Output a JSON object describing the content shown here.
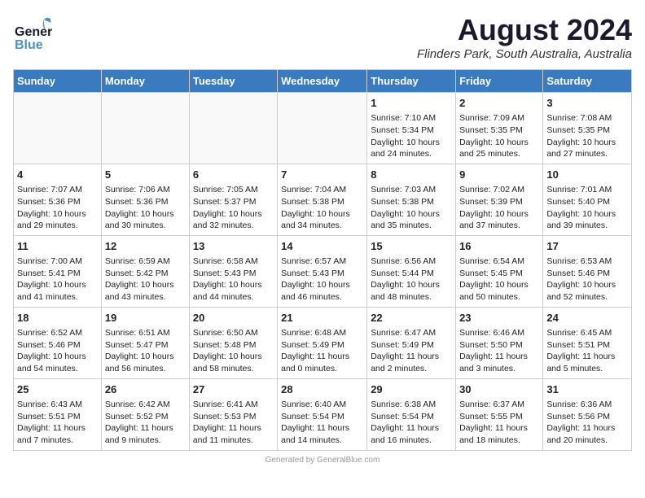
{
  "header": {
    "logo_general": "General",
    "logo_blue": "Blue",
    "month_year": "August 2024",
    "location": "Flinders Park, South Australia, Australia"
  },
  "days_of_week": [
    "Sunday",
    "Monday",
    "Tuesday",
    "Wednesday",
    "Thursday",
    "Friday",
    "Saturday"
  ],
  "weeks": [
    [
      {
        "day": "",
        "info": ""
      },
      {
        "day": "",
        "info": ""
      },
      {
        "day": "",
        "info": ""
      },
      {
        "day": "",
        "info": ""
      },
      {
        "day": "1",
        "info": "Sunrise: 7:10 AM\nSunset: 5:34 PM\nDaylight: 10 hours\nand 24 minutes."
      },
      {
        "day": "2",
        "info": "Sunrise: 7:09 AM\nSunset: 5:35 PM\nDaylight: 10 hours\nand 25 minutes."
      },
      {
        "day": "3",
        "info": "Sunrise: 7:08 AM\nSunset: 5:35 PM\nDaylight: 10 hours\nand 27 minutes."
      }
    ],
    [
      {
        "day": "4",
        "info": "Sunrise: 7:07 AM\nSunset: 5:36 PM\nDaylight: 10 hours\nand 29 minutes."
      },
      {
        "day": "5",
        "info": "Sunrise: 7:06 AM\nSunset: 5:36 PM\nDaylight: 10 hours\nand 30 minutes."
      },
      {
        "day": "6",
        "info": "Sunrise: 7:05 AM\nSunset: 5:37 PM\nDaylight: 10 hours\nand 32 minutes."
      },
      {
        "day": "7",
        "info": "Sunrise: 7:04 AM\nSunset: 5:38 PM\nDaylight: 10 hours\nand 34 minutes."
      },
      {
        "day": "8",
        "info": "Sunrise: 7:03 AM\nSunset: 5:38 PM\nDaylight: 10 hours\nand 35 minutes."
      },
      {
        "day": "9",
        "info": "Sunrise: 7:02 AM\nSunset: 5:39 PM\nDaylight: 10 hours\nand 37 minutes."
      },
      {
        "day": "10",
        "info": "Sunrise: 7:01 AM\nSunset: 5:40 PM\nDaylight: 10 hours\nand 39 minutes."
      }
    ],
    [
      {
        "day": "11",
        "info": "Sunrise: 7:00 AM\nSunset: 5:41 PM\nDaylight: 10 hours\nand 41 minutes."
      },
      {
        "day": "12",
        "info": "Sunrise: 6:59 AM\nSunset: 5:42 PM\nDaylight: 10 hours\nand 43 minutes."
      },
      {
        "day": "13",
        "info": "Sunrise: 6:58 AM\nSunset: 5:43 PM\nDaylight: 10 hours\nand 44 minutes."
      },
      {
        "day": "14",
        "info": "Sunrise: 6:57 AM\nSunset: 5:43 PM\nDaylight: 10 hours\nand 46 minutes."
      },
      {
        "day": "15",
        "info": "Sunrise: 6:56 AM\nSunset: 5:44 PM\nDaylight: 10 hours\nand 48 minutes."
      },
      {
        "day": "16",
        "info": "Sunrise: 6:54 AM\nSunset: 5:45 PM\nDaylight: 10 hours\nand 50 minutes."
      },
      {
        "day": "17",
        "info": "Sunrise: 6:53 AM\nSunset: 5:46 PM\nDaylight: 10 hours\nand 52 minutes."
      }
    ],
    [
      {
        "day": "18",
        "info": "Sunrise: 6:52 AM\nSunset: 5:46 PM\nDaylight: 10 hours\nand 54 minutes."
      },
      {
        "day": "19",
        "info": "Sunrise: 6:51 AM\nSunset: 5:47 PM\nDaylight: 10 hours\nand 56 minutes."
      },
      {
        "day": "20",
        "info": "Sunrise: 6:50 AM\nSunset: 5:48 PM\nDaylight: 10 hours\nand 58 minutes."
      },
      {
        "day": "21",
        "info": "Sunrise: 6:48 AM\nSunset: 5:49 PM\nDaylight: 11 hours\nand 0 minutes."
      },
      {
        "day": "22",
        "info": "Sunrise: 6:47 AM\nSunset: 5:49 PM\nDaylight: 11 hours\nand 2 minutes."
      },
      {
        "day": "23",
        "info": "Sunrise: 6:46 AM\nSunset: 5:50 PM\nDaylight: 11 hours\nand 3 minutes."
      },
      {
        "day": "24",
        "info": "Sunrise: 6:45 AM\nSunset: 5:51 PM\nDaylight: 11 hours\nand 5 minutes."
      }
    ],
    [
      {
        "day": "25",
        "info": "Sunrise: 6:43 AM\nSunset: 5:51 PM\nDaylight: 11 hours\nand 7 minutes."
      },
      {
        "day": "26",
        "info": "Sunrise: 6:42 AM\nSunset: 5:52 PM\nDaylight: 11 hours\nand 9 minutes."
      },
      {
        "day": "27",
        "info": "Sunrise: 6:41 AM\nSunset: 5:53 PM\nDaylight: 11 hours\nand 11 minutes."
      },
      {
        "day": "28",
        "info": "Sunrise: 6:40 AM\nSunset: 5:54 PM\nDaylight: 11 hours\nand 14 minutes."
      },
      {
        "day": "29",
        "info": "Sunrise: 6:38 AM\nSunset: 5:54 PM\nDaylight: 11 hours\nand 16 minutes."
      },
      {
        "day": "30",
        "info": "Sunrise: 6:37 AM\nSunset: 5:55 PM\nDaylight: 11 hours\nand 18 minutes."
      },
      {
        "day": "31",
        "info": "Sunrise: 6:36 AM\nSunset: 5:56 PM\nDaylight: 11 hours\nand 20 minutes."
      }
    ]
  ]
}
